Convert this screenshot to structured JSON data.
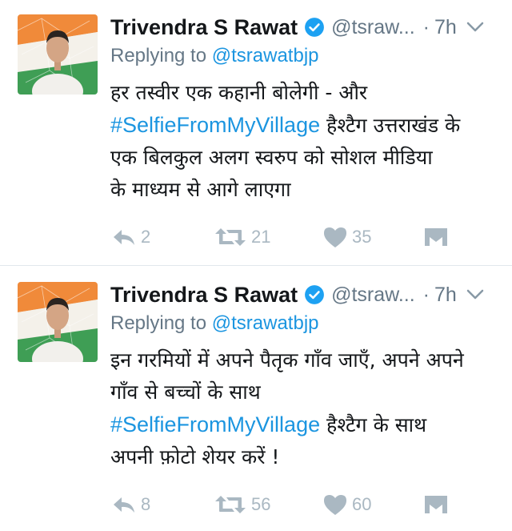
{
  "colors": {
    "text": "#14171a",
    "secondary": "#657786",
    "link": "#1b95e0",
    "action": "#aab8c2",
    "divider": "#e1e8ed"
  },
  "tweets": [
    {
      "name": "Trivendra S Rawat",
      "handle": "@tsraw...",
      "dot": "·",
      "time": "7h",
      "replying_prefix": "Replying to ",
      "replying_handle": "@tsrawatbjp",
      "lines": [
        {
          "text": "हर तस्वीर एक कहानी बोलेगी - और"
        },
        {
          "hashtag": "#SelfieFromMyVillage",
          "text": " हैश्टैग उत्तराखंड के"
        },
        {
          "text": "एक बिलकुल अलग स्वरुप को सोशल मीडिया"
        },
        {
          "text": "के माध्यम से आगे लाएगा"
        }
      ],
      "reply_count": "2",
      "retweet_count": "21",
      "like_count": "35",
      "icons": [
        "reply-icon",
        "retweet-icon",
        "heart-icon",
        "message-icon",
        "verified-icon",
        "chevron-down-icon"
      ]
    },
    {
      "name": "Trivendra S Rawat",
      "handle": "@tsraw...",
      "dot": "·",
      "time": "7h",
      "replying_prefix": "Replying to ",
      "replying_handle": "@tsrawatbjp",
      "lines": [
        {
          "text": "इन गरमियों में अपने पैतृक गाँव जाएँ, अपने अपने"
        },
        {
          "text": "गाँव से बच्चों के साथ"
        },
        {
          "hashtag": "#SelfieFromMyVillage",
          "text": " हैश्टैग के साथ"
        },
        {
          "text": "अपनी फ़ोटो शेयर करें !"
        }
      ],
      "reply_count": "8",
      "retweet_count": "56",
      "like_count": "60",
      "icons": [
        "reply-icon",
        "retweet-icon",
        "heart-icon",
        "message-icon",
        "verified-icon",
        "chevron-down-icon"
      ]
    }
  ]
}
